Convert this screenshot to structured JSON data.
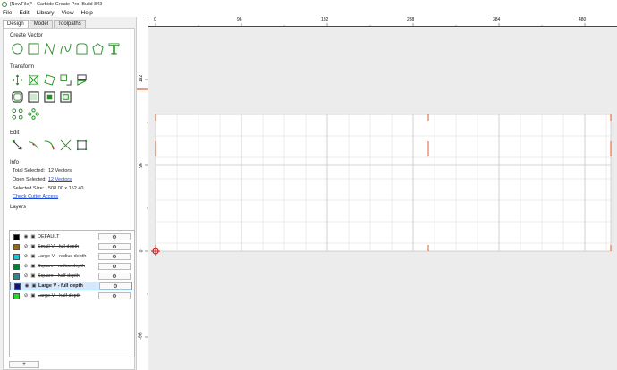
{
  "window": {
    "title": "[NewFile]* - Carbide Create Pro, Build 843"
  },
  "menu": [
    "File",
    "Edit",
    "Library",
    "View",
    "Help"
  ],
  "tabs": [
    "Design",
    "Model",
    "Toolpaths"
  ],
  "sections": {
    "create_vector": "Create Vector",
    "transform": "Transform",
    "edit": "Edit",
    "info": "Info",
    "layers": "Layers"
  },
  "info": {
    "total_selected_label": "Total Selected:",
    "total_selected_value": "12 Vectors",
    "open_selected_label": "Open Selected:",
    "open_selected_value": "12 Vectors",
    "selected_size_label": "Selected Size:",
    "selected_size_value": "508.00 x 152.40",
    "check_cutter_access": "Check Cutter Access"
  },
  "layers": [
    {
      "name": "DEFAULT",
      "color": "#000000",
      "hidden": false,
      "strike": false,
      "selected": false
    },
    {
      "name": "Small V - full depth",
      "color": "#8a6a1a",
      "hidden": true,
      "strike": true,
      "selected": false
    },
    {
      "name": "Large V - radius depth",
      "color": "#18c8d8",
      "hidden": true,
      "strike": true,
      "selected": false
    },
    {
      "name": "Square - radius depth",
      "color": "#0a7a3a",
      "hidden": true,
      "strike": true,
      "selected": false
    },
    {
      "name": "Square - half depth",
      "color": "#2a8a8a",
      "hidden": true,
      "strike": true,
      "selected": false
    },
    {
      "name": "Large V - full depth",
      "color": "#101090",
      "hidden": false,
      "strike": false,
      "selected": true
    },
    {
      "name": "Large V - half depth",
      "color": "#22dd22",
      "hidden": true,
      "strike": true,
      "selected": false
    }
  ],
  "add_layer_label": "+",
  "gear_glyph": "⚙",
  "ruler_top": [
    "0",
    "96",
    "192",
    "288",
    "384",
    "480"
  ],
  "ruler_left": [
    "192",
    "96",
    "0",
    "-96"
  ],
  "icons": {
    "create_vector": [
      "circle-icon",
      "rectangle-icon",
      "polyline-icon",
      "curve-icon",
      "rounded-rect-icon",
      "polygon-icon",
      "text-icon"
    ],
    "transform": [
      "move-icon",
      "scale-icon",
      "rotate-icon",
      "align-icon",
      "mirror-icon",
      "offset-icon",
      "boolean-union-icon",
      "boolean-subtract-icon",
      "boolean-intersect-icon",
      "group-icon",
      "linear-array-icon",
      "circular-array-icon"
    ],
    "edit": [
      "node-edit-icon",
      "trim-icon",
      "fillet-icon",
      "cut-icon",
      "join-icon"
    ]
  },
  "colors": {
    "accent": "#2a8a2a",
    "selection": "#e05a2a",
    "link": "#1a4bd6"
  }
}
